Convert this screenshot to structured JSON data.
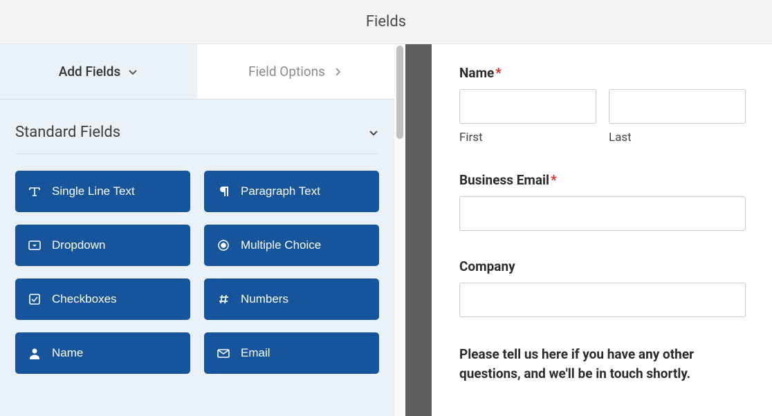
{
  "header": {
    "title": "Fields"
  },
  "tabs": {
    "add_fields": "Add Fields",
    "field_options": "Field Options"
  },
  "sidebar": {
    "section_title": "Standard Fields",
    "fields": [
      {
        "label": "Single Line Text",
        "icon": "text-icon"
      },
      {
        "label": "Paragraph Text",
        "icon": "paragraph-icon"
      },
      {
        "label": "Dropdown",
        "icon": "dropdown-icon"
      },
      {
        "label": "Multiple Choice",
        "icon": "radio-icon"
      },
      {
        "label": "Checkboxes",
        "icon": "checkbox-icon"
      },
      {
        "label": "Numbers",
        "icon": "hash-icon"
      },
      {
        "label": "Name",
        "icon": "user-icon"
      },
      {
        "label": "Email",
        "icon": "envelope-icon"
      }
    ]
  },
  "preview": {
    "name_label": "Name",
    "first_label": "First",
    "last_label": "Last",
    "email_label": "Business Email",
    "company_label": "Company",
    "description": "Please tell us here if you have any other questions, and we'll be in touch shortly."
  }
}
